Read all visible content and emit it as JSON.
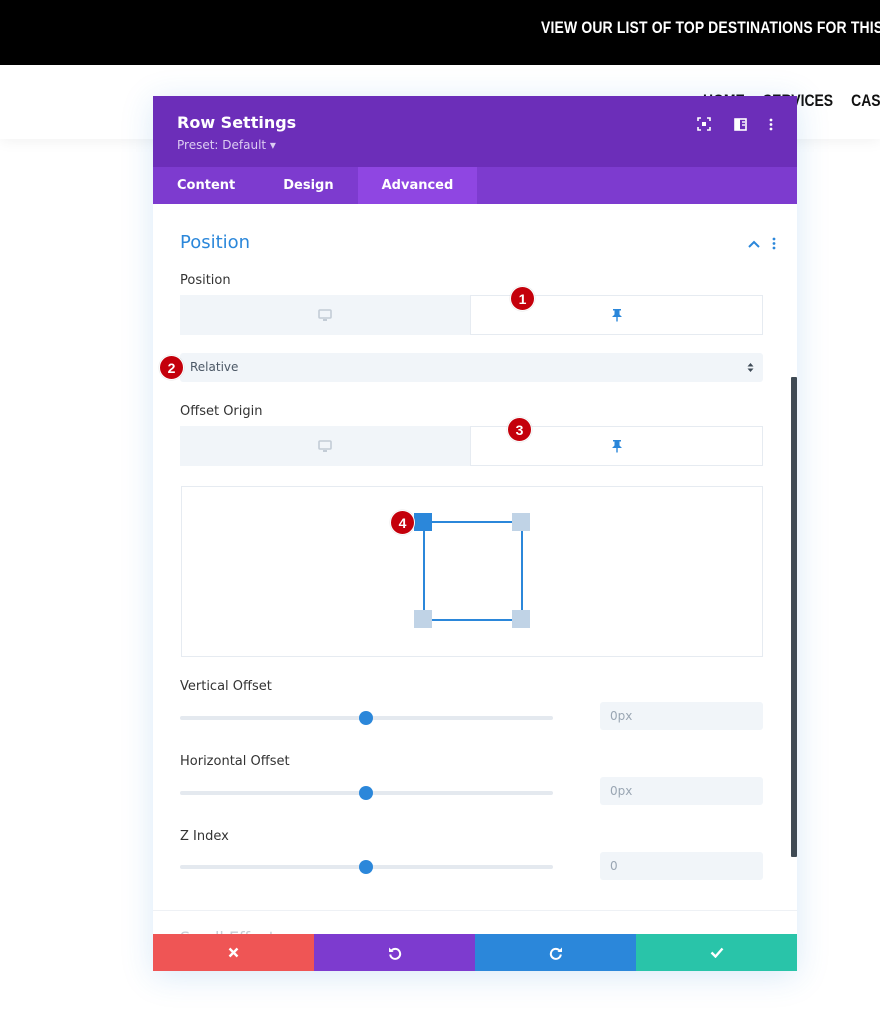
{
  "site": {
    "announcement": "VIEW OUR LIST OF TOP DESTINATIONS FOR THIS YEAR",
    "nav": [
      "HOME",
      "SERVICES",
      "CASE S"
    ]
  },
  "modal": {
    "title": "Row Settings",
    "preset": "Preset: Default ▾",
    "header_icons": [
      "fullscreen-icon",
      "split-view-icon",
      "more-icon"
    ],
    "tabs": [
      {
        "label": "Content",
        "active": false
      },
      {
        "label": "Design",
        "active": false
      },
      {
        "label": "Advanced",
        "active": true
      }
    ],
    "section": {
      "title": "Position",
      "position_label": "Position",
      "position_select": "Relative",
      "offset_origin_label": "Offset Origin",
      "offset_origin_selected": "top-left",
      "vertical_offset": {
        "label": "Vertical Offset",
        "value": "0px",
        "slider_fraction": 0.5
      },
      "horizontal_offset": {
        "label": "Horizontal Offset",
        "value": "0px",
        "slider_fraction": 0.5
      },
      "z_index": {
        "label": "Z Index",
        "value": "0",
        "slider_fraction": 0.5
      },
      "next_section_faded": "Scroll Effects"
    },
    "footer": {
      "cancel": "close-icon",
      "undo": "undo-icon",
      "redo": "redo-icon",
      "save": "check-icon"
    }
  },
  "annotations": [
    "1",
    "2",
    "3",
    "4"
  ],
  "colors": {
    "header_purple": "#6c2eb9",
    "tabs_purple": "#7d3bcf",
    "accent_blue": "#2b87da",
    "cancel_red": "#ef5555",
    "undo_purple": "#7d3bcf",
    "redo_blue": "#2b87da",
    "save_teal": "#29c4a9",
    "badge_red": "#c4000b"
  }
}
